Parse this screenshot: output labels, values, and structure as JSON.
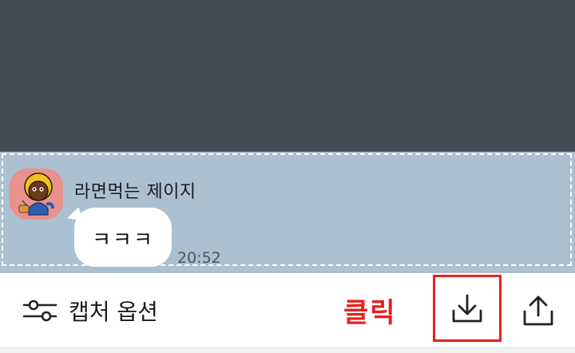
{
  "chat": {
    "sender_name": "라면먹는 제이지",
    "message_text": "ㅋㅋㅋ",
    "timestamp": "20:52"
  },
  "toolbar": {
    "options_label": "캡처 옵션",
    "annotation_text": "클릭",
    "options_icon": "sliders-icon",
    "save_icon": "download-icon",
    "share_icon": "share-icon"
  },
  "colors": {
    "dim_overlay": "#464c53",
    "chat_background": "#abc1d1",
    "annotation_red": "#e8201c",
    "avatar_background": "#e8918f"
  }
}
